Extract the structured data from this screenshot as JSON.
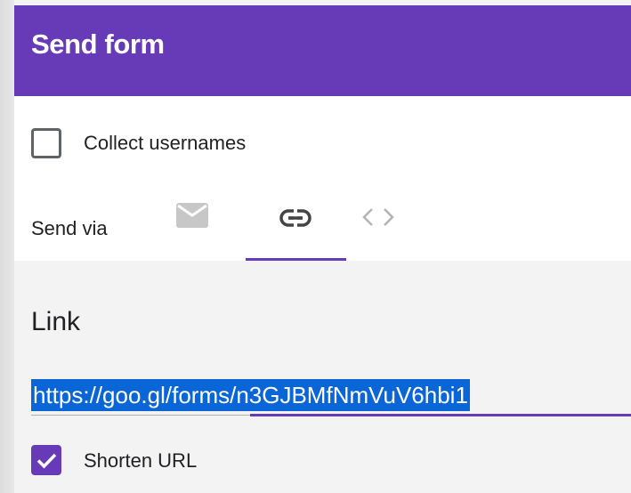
{
  "dialog": {
    "title": "Send form"
  },
  "options": {
    "collect_usernames_label": "Collect usernames",
    "collect_usernames_checked": false
  },
  "send_via": {
    "label": "Send via",
    "tabs": [
      {
        "icon": "email-icon",
        "selected": false
      },
      {
        "icon": "link-icon",
        "selected": true
      },
      {
        "icon": "embed-code-icon",
        "selected": false
      }
    ]
  },
  "link_panel": {
    "title": "Link",
    "url": "https://goo.gl/forms/n3GJBMfNmVuV6hbi1",
    "shorten_url_label": "Shorten URL",
    "shorten_url_checked": true
  },
  "colors": {
    "accent": "#673ab7",
    "selection": "#0a66d6"
  }
}
